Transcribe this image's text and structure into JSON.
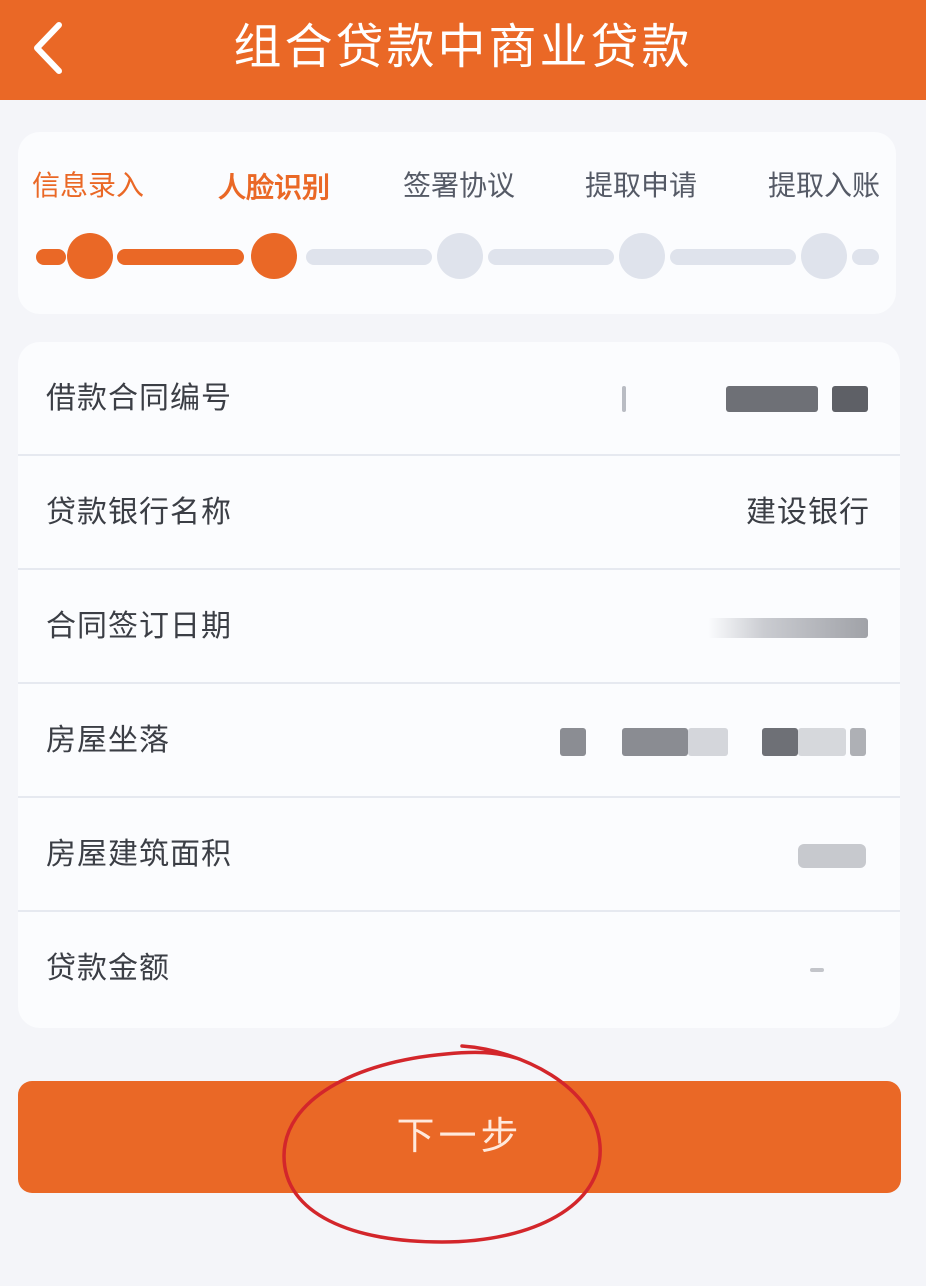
{
  "header": {
    "title": "组合贷款中商业贷款",
    "back_icon": "chevron-left-icon"
  },
  "steps": {
    "items": [
      {
        "label": "信息录入",
        "state": "done"
      },
      {
        "label": "人脸识别",
        "state": "active"
      },
      {
        "label": "签署协议",
        "state": "pending"
      },
      {
        "label": "提取申请",
        "state": "pending"
      },
      {
        "label": "提取入账",
        "state": "pending"
      }
    ],
    "current_step": 2,
    "total_steps": 5
  },
  "info": {
    "rows": [
      {
        "label": "借款合同编号",
        "value": ""
      },
      {
        "label": "贷款银行名称",
        "value": "建设银行"
      },
      {
        "label": "合同签订日期",
        "value": ""
      },
      {
        "label": "房屋坐落",
        "value": ""
      },
      {
        "label": "房屋建筑面积",
        "value": ""
      },
      {
        "label": "贷款金额",
        "value": ""
      }
    ]
  },
  "actions": {
    "next_label": "下一步"
  },
  "colors": {
    "accent": "#ea6826",
    "track_inactive": "#dfe3ec",
    "annotation": "#d3262b"
  }
}
